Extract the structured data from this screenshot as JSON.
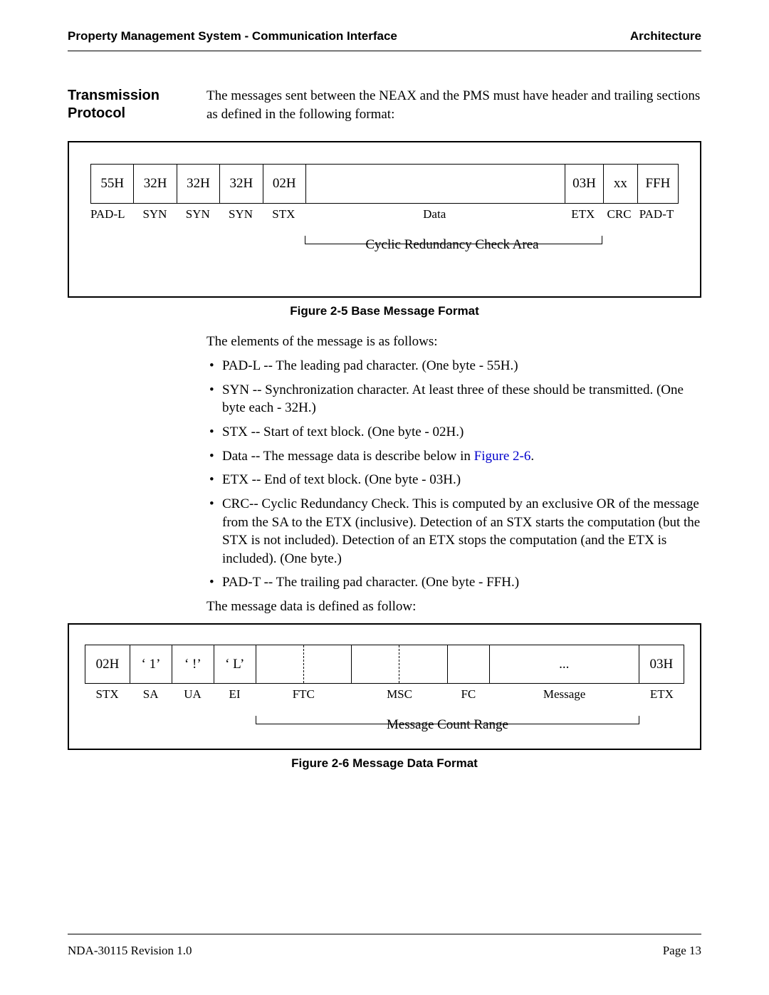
{
  "header": {
    "left": "Property Management System - Communication Interface",
    "right": "Architecture"
  },
  "section_title": "Transmission Protocol",
  "intro": "The messages sent between the NEAX and the PMS must have header and trailing sections as defined in the following format:",
  "fig1": {
    "cells": [
      "55H",
      "32H",
      "32H",
      "32H",
      "02H",
      "",
      "03H",
      "xx",
      "FFH"
    ],
    "labels": [
      "PAD-L",
      "SYN",
      "SYN",
      "SYN",
      "STX",
      "Data",
      "ETX",
      "CRC",
      "PAD-T"
    ],
    "crc_label": "Cyclic Redundancy Check Area",
    "caption": "Figure 2-5   Base Message Format"
  },
  "elements_intro": "The elements of the message is as follows:",
  "bullets": {
    "b0": "PAD-L -- The leading pad character. (One byte - 55H.)",
    "b1": "SYN -- Synchronization character. At least three of these should be transmitted. (One byte each - 32H.)",
    "b2": "STX -- Start of text block. (One byte - 02H.)",
    "b3a": "Data -- The message data is describe below in ",
    "b3_link": "Figure 2-6",
    "b3b": ".",
    "b4": "ETX -- End of text block. (One byte - 03H.)",
    "b5": "CRC-- Cyclic Redundancy Check. This is computed by an exclusive OR of the message from the SA to the ETX (inclusive). Detection of an STX starts the computation (but the STX is not included). Detection of an ETX stops the computation (and the ETX is included). (One byte.)",
    "b6": "PAD-T -- The trailing pad character. (One byte - FFH.)"
  },
  "outro": "The message data is defined as follow:",
  "fig2": {
    "cells": [
      "02H",
      "‘ 1’",
      "‘ !’",
      "‘ L’",
      "",
      "",
      "",
      "",
      "",
      "...",
      "03H"
    ],
    "labels": [
      "STX",
      "SA",
      "UA",
      "EI",
      "FTC",
      "MSC",
      "FC",
      "Message",
      "ETX"
    ],
    "mcr_label": "Message Count Range",
    "caption": "Figure 2-6   Message Data Format"
  },
  "footer": {
    "left": "NDA-30115   Revision 1.0",
    "right": "Page 13"
  }
}
